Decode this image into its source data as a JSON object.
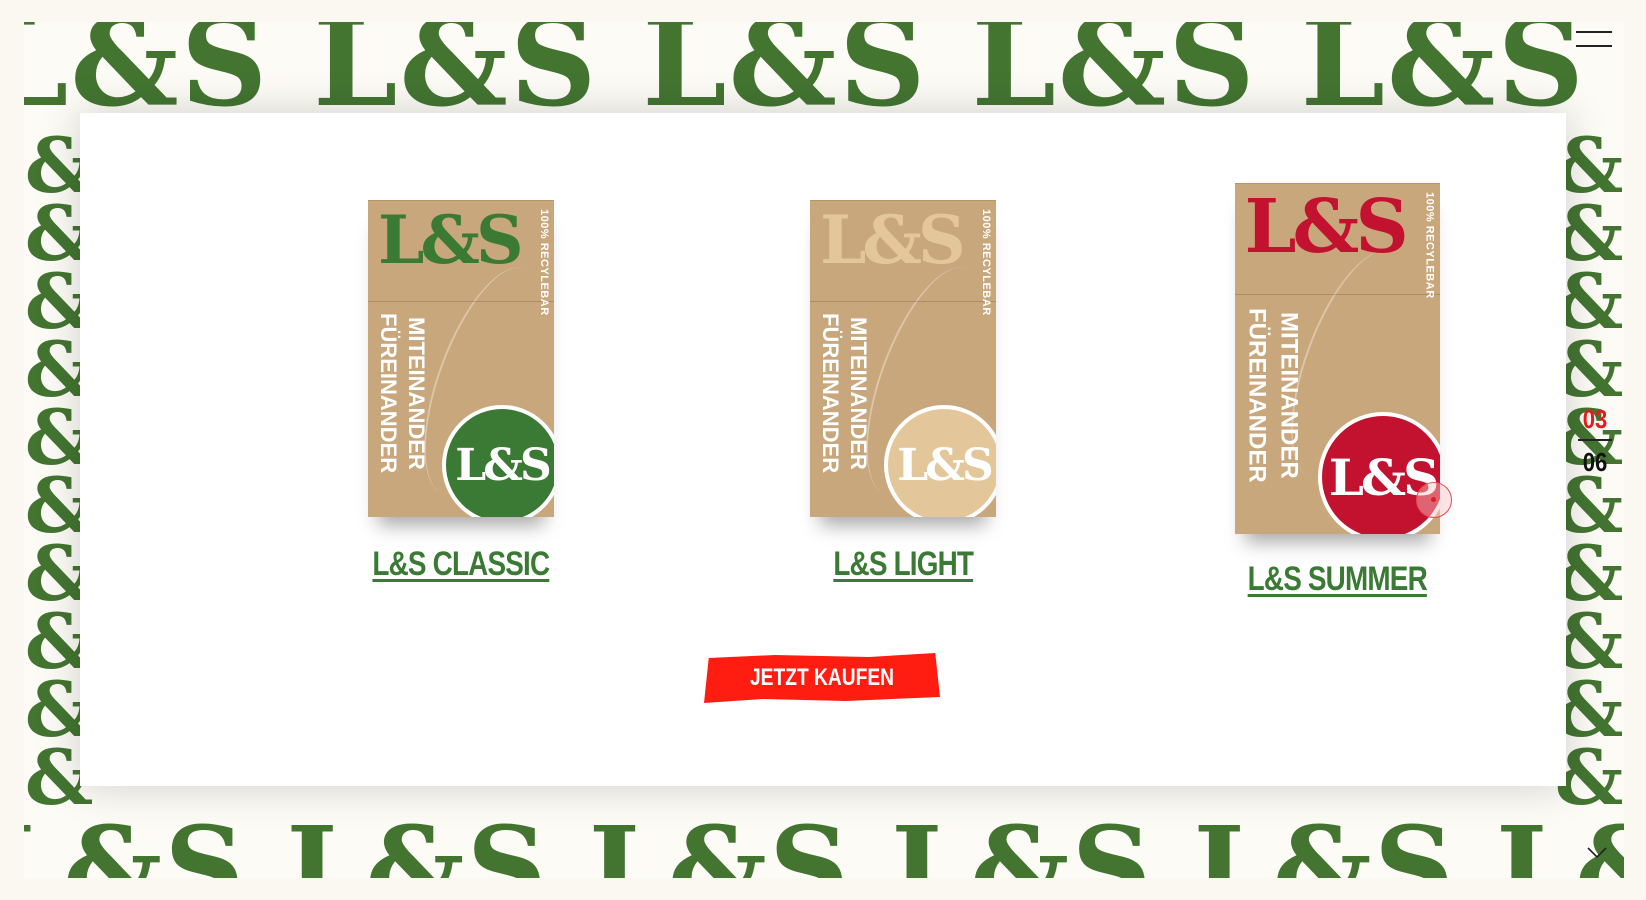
{
  "colors": {
    "brand_green": "#437531",
    "title_green": "#3b7a34",
    "accent_red": "#ff1d12",
    "summer_red": "#c3122f",
    "light_beige": "#e3c79a",
    "pack_kraft": "#c9a77c"
  },
  "pattern": {
    "top_row": "L&S L&S L&S L&S L&S L&S L&S L&S L&S L&S",
    "bottom_row": "L&S L&S L&S L&S L&S L&S L&S L&S L&S L&S",
    "side_glyph": "&"
  },
  "header": {
    "menu_icon": "hamburger-menu-icon"
  },
  "products": [
    {
      "title": "L&S CLASSIC",
      "brand": "L&S",
      "recycle_text": "100% RECYLEBAR",
      "motto_line1": "MITEINANDER",
      "motto_line2": "FÜREINANDER",
      "seal": "L&S",
      "color": "#3b7a34"
    },
    {
      "title": "L&S LIGHT",
      "brand": "L&S",
      "recycle_text": "100% RECYLEBAR",
      "motto_line1": "MITEINANDER",
      "motto_line2": "FÜREINANDER",
      "seal": "L&S",
      "color": "#e3c79a"
    },
    {
      "title": "L&S SUMMER",
      "brand": "L&S",
      "recycle_text": "100% RECYLEBAR",
      "motto_line1": "MITEINANDER",
      "motto_line2": "FÜREINANDER",
      "seal": "L&S",
      "color": "#c3122f"
    }
  ],
  "cta": {
    "label": "JETZT KAUFEN"
  },
  "pager": {
    "current": "03",
    "total": "06"
  },
  "footer": {
    "scroll_icon": "chevron-down-icon"
  }
}
